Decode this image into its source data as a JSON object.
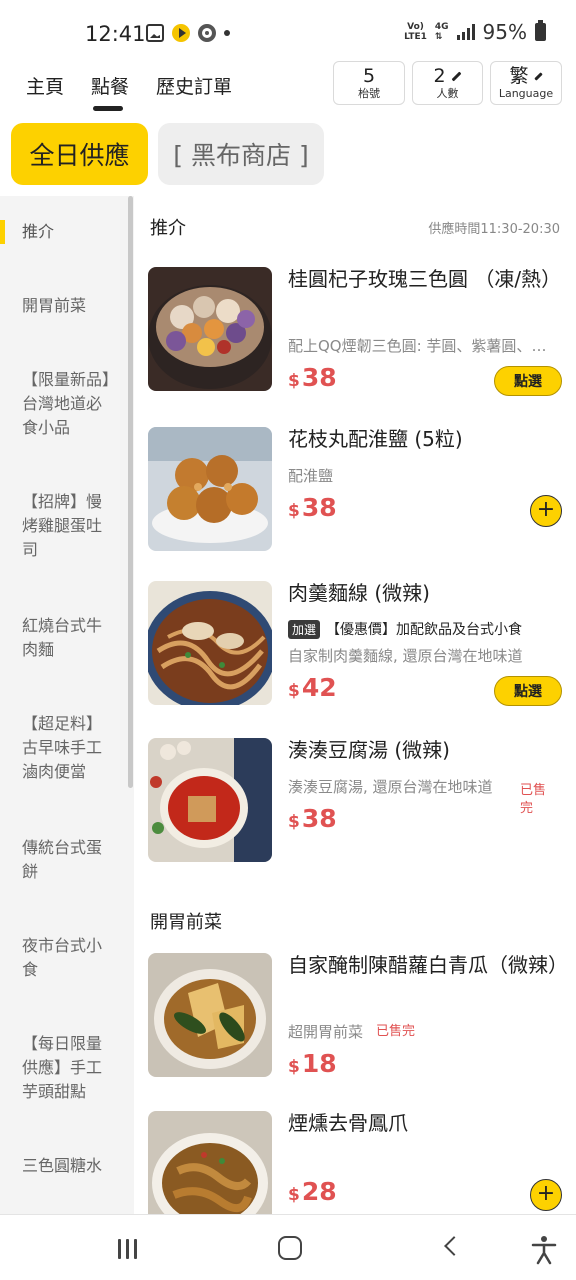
{
  "status_bar": {
    "time": "12:41",
    "network_top": "Vo)",
    "network_bottom": "LTE1",
    "net_type": "4G",
    "battery": "95%"
  },
  "top_nav": {
    "tabs": [
      "主頁",
      "點餐",
      "歷史訂單"
    ],
    "active_tab": "點餐",
    "table": {
      "value": "5",
      "label": "枱號"
    },
    "people": {
      "value": "2",
      "label": "人數"
    },
    "language": {
      "value": "繁",
      "label": "Language"
    }
  },
  "menu_modes": {
    "active": "全日供應",
    "other": "[ 黑布商店 ]"
  },
  "sidebar": {
    "items": [
      "推介",
      "開胃前菜",
      "【限量新品】台灣地道必食小品",
      "【招牌】慢烤雞腿蛋吐司",
      "紅燒台式牛肉麵",
      "【超足料】古早味手工滷肉便當",
      "傳統台式蛋餅",
      "夜市台式小食",
      "【每日限量供應】手工芋頭甜點",
      "三色圓糖水"
    ]
  },
  "sections": [
    {
      "title": "推介",
      "hours": "供應時間11:30-20:30",
      "items": [
        {
          "name": "桂圓杞子玫瑰三色圓 （凍/熱）",
          "desc": "配上QQ煙韌三色圓: 芋圓、紫薯圓、番薯圓",
          "currency": "$",
          "price": "38",
          "action": "點選"
        },
        {
          "name": "花枝丸配淮鹽 (5粒)",
          "desc": "配淮鹽",
          "currency": "$",
          "price": "38",
          "action": "+"
        },
        {
          "name": "肉羹麵線 (微辣)",
          "tag": "加選",
          "promo": "【優惠價】加配飲品及台式小食",
          "desc": "自家制肉羹麵線, 還原台灣在地味道",
          "currency": "$",
          "price": "42",
          "action": "點選"
        },
        {
          "name": "湊湊豆腐湯 (微辣)",
          "desc": "湊湊豆腐湯, 還原台灣在地味道",
          "currency": "$",
          "price": "38",
          "status": "已售完"
        }
      ]
    },
    {
      "title": "開胃前菜",
      "items": [
        {
          "name": "自家醃制陳醋蘿白青瓜（微辣）",
          "desc": "超開胃前菜",
          "status": "已售完",
          "currency": "$",
          "price": "18"
        },
        {
          "name": "煙燻去骨鳳爪",
          "currency": "$",
          "price": "28",
          "action": "+"
        }
      ]
    }
  ],
  "colors": {
    "accent": "#fdd100",
    "price": "#e05252",
    "sidebar_bg": "#f4f4f4"
  }
}
